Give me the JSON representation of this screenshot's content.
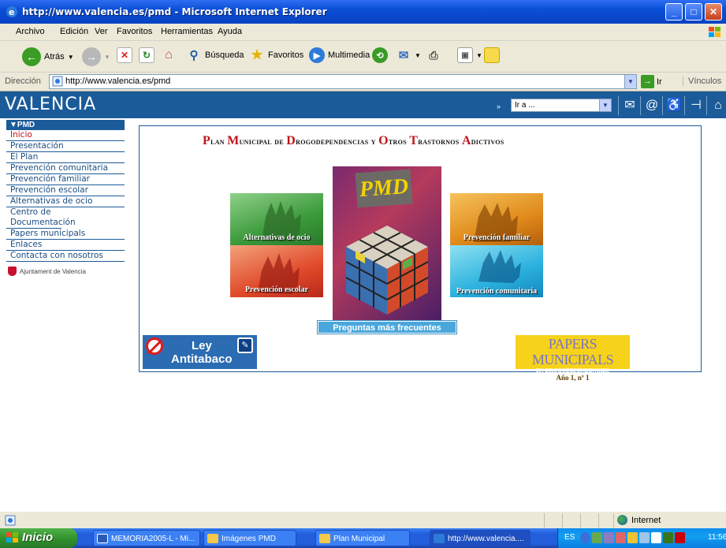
{
  "window": {
    "title": "http://www.valencia.es/pmd - Microsoft Internet Explorer",
    "minimize": "_",
    "maximize": "□",
    "close": "✕"
  },
  "menu": [
    "Archivo",
    "Edición",
    "Ver",
    "Favoritos",
    "Herramientas",
    "Ayuda"
  ],
  "toolbar": {
    "back": "Atrás",
    "search": "Búsqueda",
    "favorites": "Favoritos",
    "multimedia": "Multimedia"
  },
  "address": {
    "label": "Dirección",
    "url": "http://www.valencia.es/pmd",
    "go": "Ir",
    "links": "Vínculos"
  },
  "site": {
    "logo": "VALENCIA",
    "goto_select": "Ir a ..."
  },
  "sidebar": {
    "header": "▼PMD",
    "items": [
      "Inicio",
      "Presentación",
      "El Plan",
      "Prevención comunitaria",
      "Prevención familiar",
      "Prevención escolar",
      "Alternativas de ocio",
      "Centro de Documentación",
      "Papers municipals",
      "Enlaces",
      "Contacta con nosotros"
    ],
    "ayuntamiento": "Ajuntament de Valencia"
  },
  "main": {
    "title_parts": [
      {
        "cap": "P",
        "rest": "lan "
      },
      {
        "cap": "M",
        "rest": "unicipal de "
      },
      {
        "cap": "D",
        "rest": "rogodependencias y "
      },
      {
        "cap": "O",
        "rest": "tros "
      },
      {
        "cap": "T",
        "rest": "rastornos "
      },
      {
        "cap": "A",
        "rest": "dictivos"
      }
    ],
    "tiles": {
      "alternativas": "Alternativas de ocio",
      "escolar": "Prevención escolar",
      "familiar": "Prevención familiar",
      "comunitaria": "Prevención comunitaria"
    },
    "pmd_logo": "PMD",
    "faq": "Preguntas más frecuentes",
    "ley_1": "Ley",
    "ley_2": "Antitabaco",
    "papers_1": "PAPERS MUNICIPALS",
    "papers_2": "EN DROGODEPENDENCIES",
    "papers_3": "Año 1,  nº 1"
  },
  "status": {
    "zone": "Internet"
  },
  "taskbar": {
    "start": "Inicio",
    "tasks": [
      "MEMORIA2005-L - Mi...",
      "Imágenes PMD",
      "Plan Municipal",
      "http://www.valencia...."
    ],
    "lang": "ES",
    "clock": "11:56"
  },
  "colors": {
    "accent": "#1b5b99",
    "title_caps": "#c0151b",
    "faq": "#4aa7dc",
    "papers_bg": "#f6d21a"
  }
}
